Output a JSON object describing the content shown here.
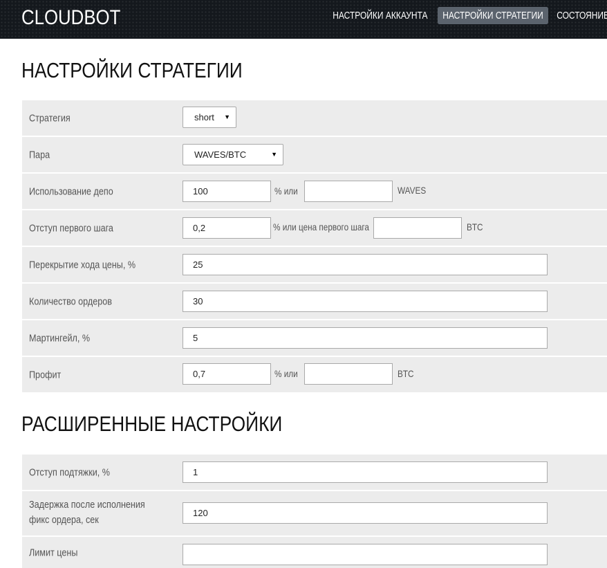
{
  "header": {
    "brand": "CLOUDBOT",
    "nav": [
      {
        "label": "НАСТРОЙКИ АККАУНТА"
      },
      {
        "label": "НАСТРОЙКИ СТРАТЕГИИ"
      },
      {
        "label": "СОСТОЯНИЕ"
      }
    ],
    "active_nav": "НАСТРОЙКИ СТРАТЕГИИ"
  },
  "strategy_section": {
    "title": "НАСТРОЙКИ СТРАТЕГИИ",
    "rows": {
      "strategy": {
        "label": "Стратегия",
        "value": "short"
      },
      "pair": {
        "label": "Пара",
        "value": "WAVES/BTC"
      },
      "deposit": {
        "label": "Использование депо",
        "percent_value": "100",
        "joiner": "%  или",
        "amount_value": "",
        "unit": "WAVES"
      },
      "first_step": {
        "label": "Отступ первого шага",
        "percent_value": "0,2",
        "joiner": "% или цена первого шага",
        "price_value": "",
        "unit": "BTC"
      },
      "price_overlap": {
        "label": "Перекрытие хода цены, %",
        "value": "25"
      },
      "orders_count": {
        "label": "Количество ордеров",
        "value": "30"
      },
      "martingale": {
        "label": "Мартингейл, %",
        "value": "5"
      },
      "profit": {
        "label": "Профит",
        "percent_value": "0,7",
        "joiner": "%  или",
        "amount_value": "",
        "unit": "BTC"
      }
    }
  },
  "advanced_section": {
    "title": "РАСШИРЕННЫЕ НАСТРОЙКИ",
    "rows": {
      "trailing": {
        "label": "Отступ подтяжки, %",
        "value": "1"
      },
      "delay": {
        "label": "Задержка после исполнения фикс ордера, сек",
        "value": "120"
      },
      "price_limit": {
        "label": "Лимит цены",
        "value": ""
      }
    }
  },
  "colors": {
    "header_bg": "#14181d",
    "active_nav_bg": "#5b636d",
    "row_bg": "#ececec",
    "input_border": "#a9a9a9"
  },
  "icons": {
    "select_arrow": "▼"
  }
}
